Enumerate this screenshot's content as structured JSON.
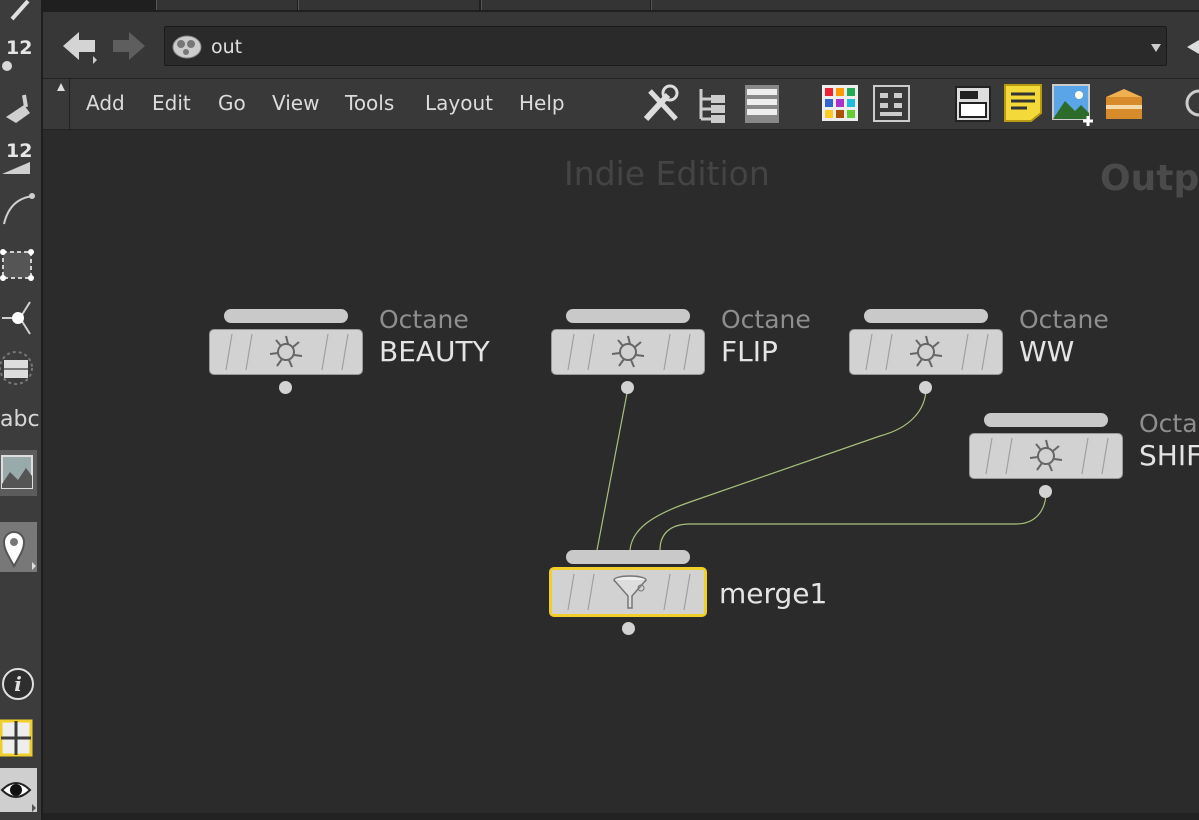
{
  "path": {
    "value": "out"
  },
  "menu": [
    {
      "label": "Add"
    },
    {
      "label": "Edit"
    },
    {
      "label": "Go"
    },
    {
      "label": "View"
    },
    {
      "label": "Tools"
    },
    {
      "label": "Layout"
    },
    {
      "label": "Help"
    }
  ],
  "left_toolbar": {
    "label_count_1": "12",
    "label_count_2": "12",
    "label_text": "abc"
  },
  "watermark": {
    "edition": "Indie Edition",
    "context": "Outp"
  },
  "nodes": [
    {
      "type": "Octane",
      "name": "BEAUTY"
    },
    {
      "type": "Octane",
      "name": "FLIP"
    },
    {
      "type": "Octane",
      "name": "WW"
    },
    {
      "type": "Octa",
      "name": "SHIF"
    },
    {
      "type": "",
      "name": "merge1"
    }
  ],
  "colors": {
    "wire": "#a8c07e",
    "selected_border": "#f0cf2a",
    "node_body": "#d2d2d2"
  }
}
